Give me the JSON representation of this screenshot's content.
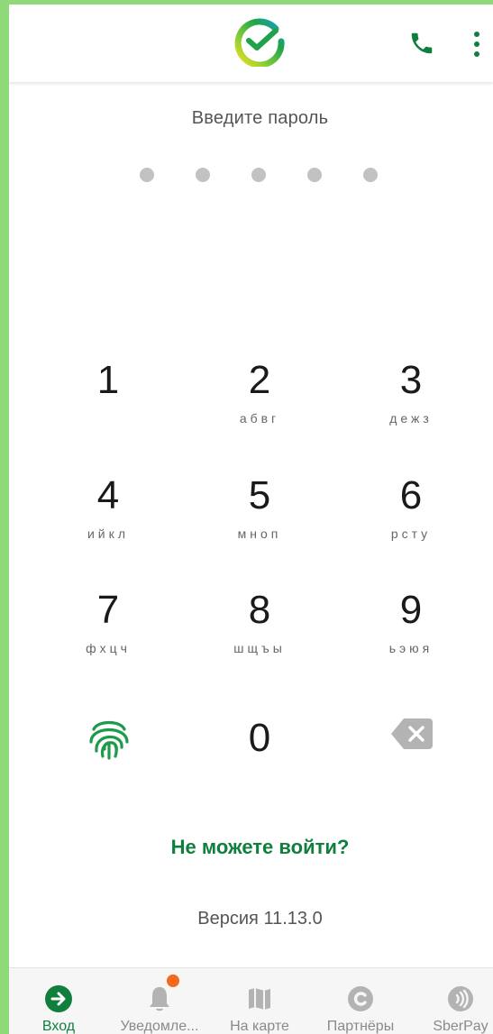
{
  "colors": {
    "accent": "#107f3e",
    "frame": "#8fd97a",
    "dot": "#c2c2c2",
    "badge": "#f36a1a"
  },
  "header": {
    "logo_icon": "sber-logo-icon",
    "call_icon": "phone-icon",
    "menu_icon": "more-vertical-icon"
  },
  "title": "Введите пароль",
  "pin_dots": 5,
  "keypad": [
    {
      "num": "1",
      "letters": ""
    },
    {
      "num": "2",
      "letters": "абвг"
    },
    {
      "num": "3",
      "letters": "дежз"
    },
    {
      "num": "4",
      "letters": "ийкл"
    },
    {
      "num": "5",
      "letters": "мноп"
    },
    {
      "num": "6",
      "letters": "рсту"
    },
    {
      "num": "7",
      "letters": "фхцч"
    },
    {
      "num": "8",
      "letters": "шщъы"
    },
    {
      "num": "9",
      "letters": "ьэюя"
    },
    {
      "num": "0",
      "letters": ""
    }
  ],
  "fingerprint_icon": "fingerprint-icon",
  "backspace_icon": "backspace-icon",
  "cant_login": "Не можете войти?",
  "version": "Версия 11.13.0",
  "bottom_nav": [
    {
      "label": "Вход",
      "icon": "login-arrow-icon",
      "active": true
    },
    {
      "label": "Уведомле...",
      "icon": "bell-icon",
      "badge": true
    },
    {
      "label": "На карте",
      "icon": "map-icon"
    },
    {
      "label": "Партнёры",
      "icon": "partners-icon"
    },
    {
      "label": "SberPay",
      "icon": "sberpay-icon"
    }
  ]
}
